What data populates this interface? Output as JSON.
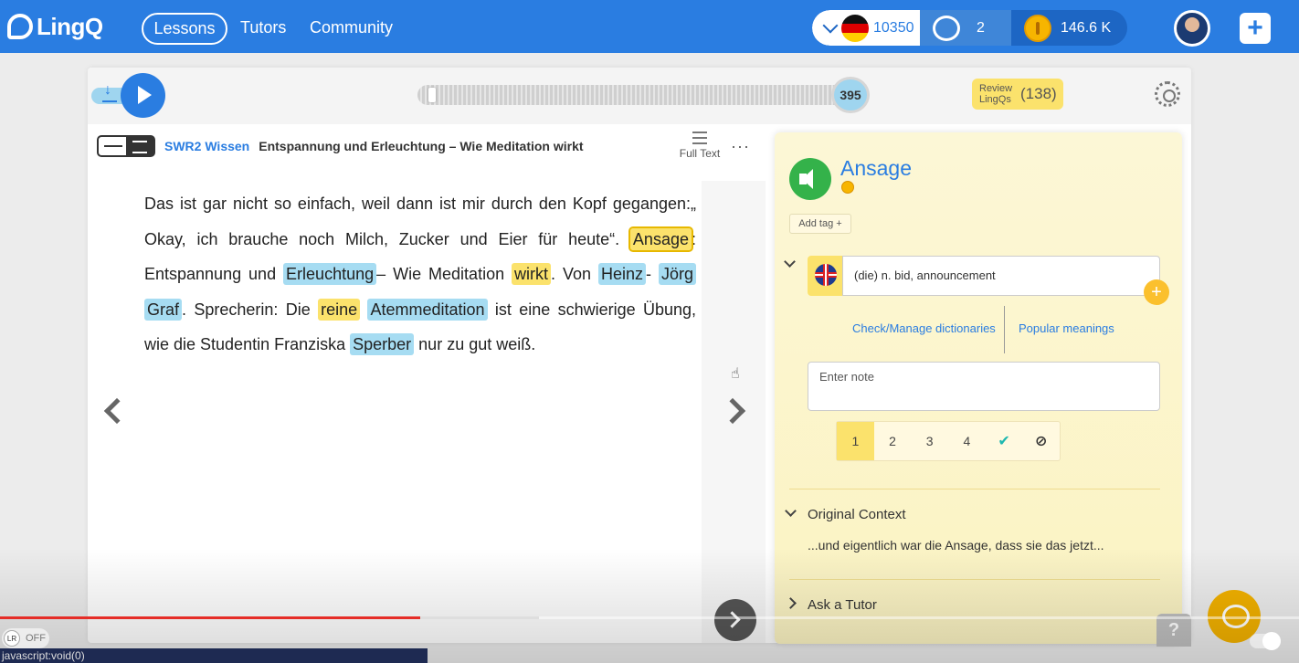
{
  "nav": {
    "logo": "LingQ",
    "lessons": "Lessons",
    "tutors": "Tutors",
    "community": "Community"
  },
  "stats": {
    "known_words": "10350",
    "streak": "2",
    "coins": "146.6 K"
  },
  "icons": {
    "language": "german-flag-icon",
    "streak": "apple-icon",
    "coins": "coin-icon",
    "add": "plus-icon"
  },
  "player": {
    "position": "395",
    "review_label": "Review LingQs",
    "review_count": "(138)"
  },
  "lesson": {
    "course": "SWR2 Wissen",
    "title": "Entspannung und Erleuchtung – Wie Meditation wirkt",
    "full_text_label": "Full Text",
    "more": "···"
  },
  "reading": {
    "t1": "Das ist gar nicht so einfach, weil dann ist mir durch den Kopf gegangen:„ Okay, ich brauche noch Milch, Zucker und Eier für heute“. ",
    "w_ansage": "Ansage",
    "t2": ": Entspannung und ",
    "w_erleuchtung": "Erleuchtung",
    "t3": "– Wie Meditation ",
    "w_wirkt": "wirkt",
    "t4": ". Von ",
    "w_heinz": "Heinz",
    "t5": "- ",
    "w_joerg": "Jörg",
    "t6": " ",
    "w_graf": "Graf",
    "t7": ". Sprecherin: Die ",
    "w_reine": "reine",
    "t8": " ",
    "w_atem": "Atemmeditation",
    "t9": " ist eine schwierige Übung, wie die Studentin Franziska ",
    "w_sperber": "Sperber",
    "t10": " nur zu gut weiß."
  },
  "panel": {
    "term": "Ansage",
    "add_tag": "Add tag +",
    "hint": "(die) n. bid, announcement",
    "check_dict": "Check/Manage dictionaries",
    "popular": "Popular meanings",
    "note_placeholder": "Enter note",
    "status": [
      "1",
      "2",
      "3",
      "4",
      "✔",
      "⊘"
    ],
    "original_context_title": "Original Context",
    "original_context": "...und eigentlich war die Ansage, dass sie das jetzt...",
    "ask_tutor": "Ask a Tutor"
  },
  "misc": {
    "help": "?",
    "lr_off": "OFF",
    "lr_badge": "LR",
    "status_url": "javascript:void(0)"
  },
  "colors": {
    "brand": "#2a7de1",
    "highlight_yellow": "#fbe26c",
    "highlight_blue": "#a6dcf2",
    "speaker_green": "#34b24a",
    "chat_orange": "#f2b100"
  }
}
